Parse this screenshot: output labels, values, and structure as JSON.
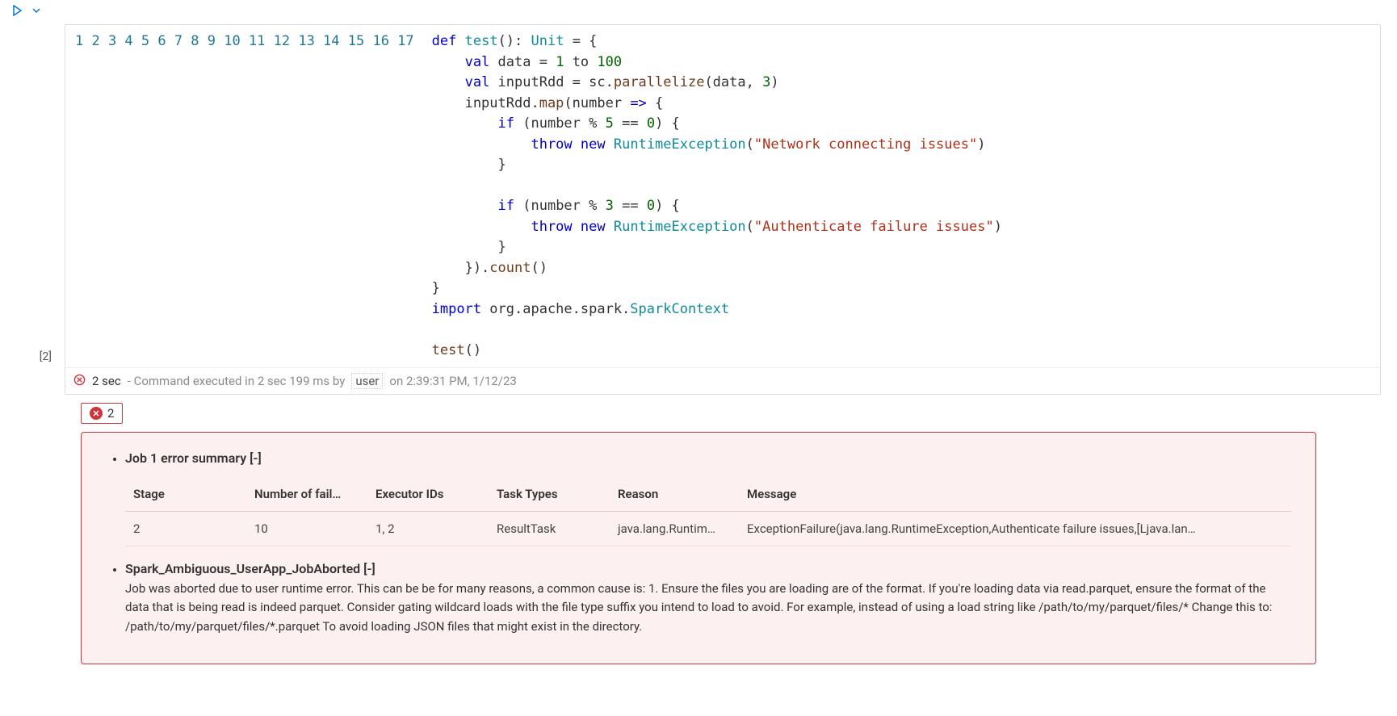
{
  "toolbar": {
    "run_title": "Run",
    "dropdown_title": "Run options"
  },
  "gutter": {
    "exec_count": "[2]"
  },
  "code": {
    "line_count": 17,
    "tokens": [
      [
        [
          "",
          "kw",
          "def"
        ],
        [
          " ",
          "",
          ""
        ],
        [
          "",
          "def",
          "test"
        ],
        [
          "(): ",
          "",
          ""
        ],
        [
          "",
          "type",
          "Unit"
        ],
        [
          " = {",
          "",
          ""
        ]
      ],
      [
        [
          "    ",
          "",
          ""
        ],
        [
          "",
          "kw",
          "val"
        ],
        [
          " data = ",
          "",
          ""
        ],
        [
          "",
          "num",
          "1"
        ],
        [
          " to ",
          "",
          ""
        ],
        [
          "",
          "num",
          "100"
        ]
      ],
      [
        [
          "    ",
          "",
          ""
        ],
        [
          "",
          "kw",
          "val"
        ],
        [
          " inputRdd = sc.",
          "",
          ""
        ],
        [
          "",
          "fn",
          "parallelize"
        ],
        [
          "(data, ",
          "",
          ""
        ],
        [
          "",
          "num",
          "3"
        ],
        [
          ")",
          "",
          ""
        ]
      ],
      [
        [
          "    inputRdd.",
          "",
          ""
        ],
        [
          "",
          "fn",
          "map"
        ],
        [
          "(number ",
          "",
          ""
        ],
        [
          "",
          "kw",
          "=>"
        ],
        [
          " {",
          "",
          ""
        ]
      ],
      [
        [
          "        ",
          "",
          ""
        ],
        [
          "",
          "kw",
          "if"
        ],
        [
          " (number % ",
          "",
          ""
        ],
        [
          "",
          "num",
          "5"
        ],
        [
          " == ",
          "",
          ""
        ],
        [
          "",
          "num",
          "0"
        ],
        [
          ") {",
          "",
          ""
        ]
      ],
      [
        [
          "            ",
          "",
          ""
        ],
        [
          "",
          "kw",
          "throw"
        ],
        [
          " ",
          "",
          ""
        ],
        [
          "",
          "kw",
          "new"
        ],
        [
          " ",
          "",
          ""
        ],
        [
          "",
          "type",
          "RuntimeException"
        ],
        [
          "(",
          "",
          ""
        ],
        [
          "",
          "str",
          "\"Network connecting issues\""
        ],
        [
          ")",
          "",
          ""
        ]
      ],
      [
        [
          "        }",
          "",
          ""
        ]
      ],
      [
        [
          "",
          "",
          ""
        ]
      ],
      [
        [
          "        ",
          "",
          ""
        ],
        [
          "",
          "kw",
          "if"
        ],
        [
          " (number % ",
          "",
          ""
        ],
        [
          "",
          "num",
          "3"
        ],
        [
          " == ",
          "",
          ""
        ],
        [
          "",
          "num",
          "0"
        ],
        [
          ") {",
          "",
          ""
        ]
      ],
      [
        [
          "            ",
          "",
          ""
        ],
        [
          "",
          "kw",
          "throw"
        ],
        [
          " ",
          "",
          ""
        ],
        [
          "",
          "kw",
          "new"
        ],
        [
          " ",
          "",
          ""
        ],
        [
          "",
          "type",
          "RuntimeException"
        ],
        [
          "(",
          "",
          ""
        ],
        [
          "",
          "str",
          "\"Authenticate failure issues\""
        ],
        [
          ")",
          "",
          ""
        ]
      ],
      [
        [
          "        }",
          "",
          ""
        ]
      ],
      [
        [
          "    }).",
          "",
          ""
        ],
        [
          "",
          "fn",
          "count"
        ],
        [
          "()",
          "",
          ""
        ]
      ],
      [
        [
          "}",
          "",
          ""
        ]
      ],
      [
        [
          "",
          "kw",
          "import"
        ],
        [
          " org.apache.spark.",
          "",
          ""
        ],
        [
          "",
          "type",
          "SparkContext"
        ]
      ],
      [
        [
          "",
          "",
          ""
        ]
      ],
      [
        [
          "",
          "fn",
          "test"
        ],
        [
          "()",
          "",
          ""
        ]
      ],
      [
        [
          "",
          "",
          ""
        ]
      ]
    ]
  },
  "status": {
    "duration": "2 sec",
    "executed_in": " - Command executed in 2 sec 199 ms by",
    "user": "user",
    "at": " on 2:39:31 PM, 1/12/23"
  },
  "errors": {
    "tab_count": "2",
    "items": [
      {
        "title": "Job 1 error summary",
        "collapse": "[-]",
        "table": {
          "columns": [
            "Stage",
            "Number of fail…",
            "Executor IDs",
            "Task Types",
            "Reason",
            "Message"
          ],
          "rows": [
            [
              "2",
              "10",
              "1, 2",
              "ResultTask",
              "java.lang.Runtim…",
              "ExceptionFailure(java.lang.RuntimeException,Authenticate failure issues,[Ljava.lan…"
            ]
          ]
        }
      },
      {
        "title": "Spark_Ambiguous_UserApp_JobAborted",
        "collapse": "[-]",
        "desc": "Job was aborted due to user runtime error. This can be be for many reasons, a common cause is: 1. Ensure the files you are loading are of the format. If you're loading data via read.parquet, ensure the format of the data that is being read is indeed parquet. Consider gating wildcard loads with the file type suffix you intend to load to avoid. For example, instead of using a load string like /path/to/my/parquet/files/* Change this to: /path/to/my/parquet/files/*.parquet To avoid loading JSON files that might exist in the directory."
      }
    ]
  }
}
